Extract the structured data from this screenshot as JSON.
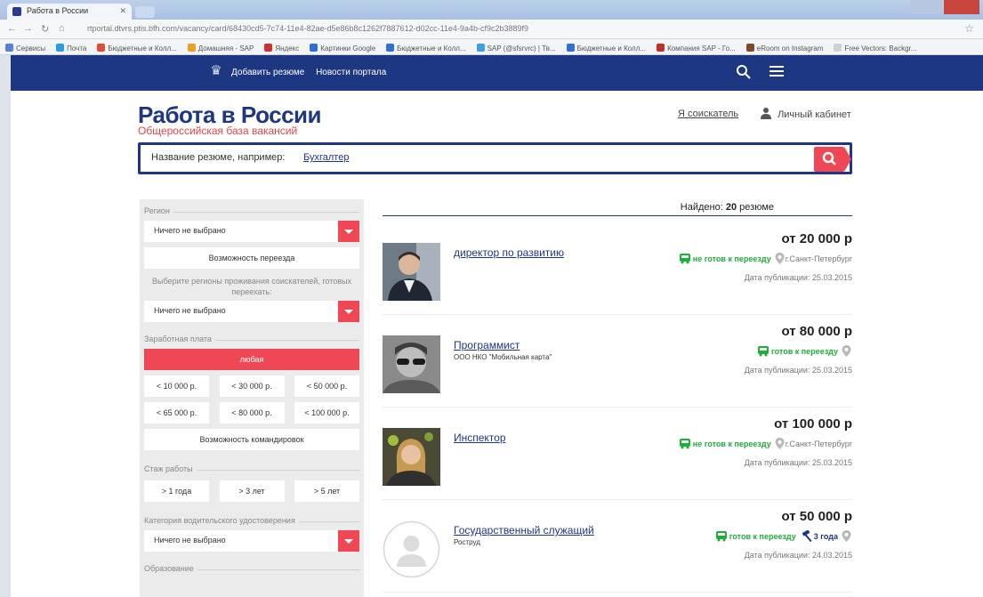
{
  "browser": {
    "tab_title": "Работа в России",
    "url": "rtportal.dtvrs.ptis.bfh.com/vacancy/card/68430cd5-7c74-11e4-82ae-d5e86b8c1262f7887612-d02cc-11e4-9a4b-cf9c2b3889f9",
    "bookmarks": [
      "Сервисы",
      "Почта",
      "Бюджетные и Колл...",
      "Домашняя - SAP",
      "Яндекс",
      "Картинки Google",
      "Бюджетные и Колл...",
      "SAP (@sfsrvrc) | Тв...",
      "Бюджетные и Колл...",
      "Компания SAP - Го...",
      "eRoom on Instagram",
      "Free Vectors: Backgr..."
    ]
  },
  "header": {
    "nav": [
      "Добавить резюме",
      "Новости портала"
    ]
  },
  "logo": {
    "title": "Работа в России",
    "subtitle": "Общероссийская база вакансий"
  },
  "top_links": {
    "seeker": "Я соискатель",
    "cabinet": "Личный кабинет"
  },
  "search": {
    "hint": "Название резюме, например:",
    "example": "Бухгалтер"
  },
  "filters": {
    "region_label": "Регион",
    "region_value": "Ничего не выбрано",
    "relocation_button": "Возможность переезда",
    "relocation_hint": "Выберите регионы проживания соискателей, готовых переехать:",
    "relocation_value": "Ничего не выбрано",
    "salary_label": "Заработная плата",
    "salary_any": "любая",
    "salary_options": [
      "< 10 000 р.",
      "< 30 000 р.",
      "< 50 000 р.",
      "< 65 000 р.",
      "< 80 000 р.",
      "< 100 000 р."
    ],
    "business_trips_button": "Возможность командировок",
    "experience_label": "Стаж работы",
    "experience_options": [
      "> 1 года",
      "> 3 лет",
      "> 5 лет"
    ],
    "license_label": "Категория водительского удостоверения",
    "license_value": "Ничего не выбрано",
    "education_label": "Образование"
  },
  "results": {
    "found_label": "Найдено:",
    "found_count": "20",
    "found_suffix": "резюме",
    "items": [
      {
        "title": "директор по развитию",
        "org": "",
        "salary": "от 20 000 р",
        "relocation": "не готов к переезду",
        "city": "г.Санкт-Петербург",
        "experience": "",
        "date": "Дата публикации: 25.03.2015"
      },
      {
        "title": "Программист",
        "org": "ООО НКО \"Мобильная карта\"",
        "salary": "от 80 000 р",
        "relocation": "готов к переезду",
        "city": "",
        "experience": "",
        "date": "Дата публикации: 25.03.2015"
      },
      {
        "title": "Инспектор",
        "org": "",
        "salary": "от 100 000 р",
        "relocation": "не готов к переезду",
        "city": "г.Санкт-Петербург",
        "experience": "",
        "date": "Дата публикации: 25.03.2015"
      },
      {
        "title": "Государственный служащий",
        "org": "Роструд",
        "salary": "от 50 000 р",
        "relocation": "готов к переезду",
        "city": "",
        "experience": "3 года",
        "date": "Дата публикации: 24.03.2015"
      }
    ]
  },
  "colors": {
    "brand": "#1e3782",
    "accent": "#f04754",
    "relocation": "#1fae3a"
  }
}
